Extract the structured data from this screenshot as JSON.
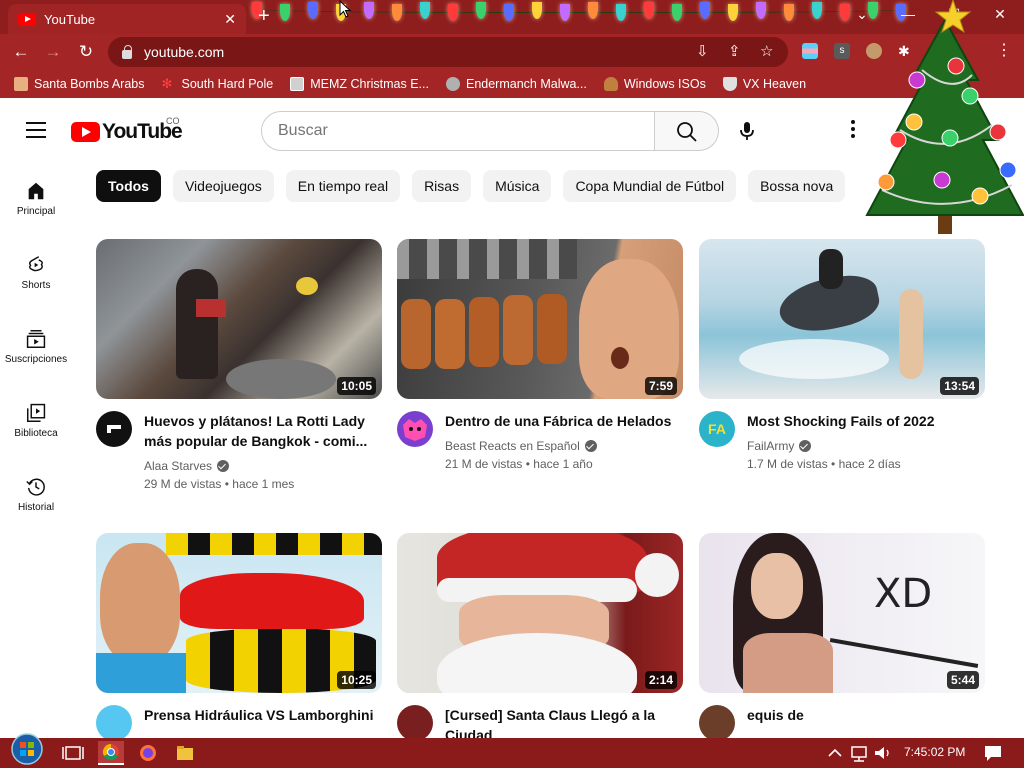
{
  "browser": {
    "tab_title": "YouTube",
    "url": "youtube.com",
    "bookmarks": [
      {
        "label": "Santa Bombs Arabs",
        "icon": "santa-icon",
        "color": "#e8b080"
      },
      {
        "label": "South Hard Pole",
        "icon": "snowflake-icon",
        "color": "#ff4040"
      },
      {
        "label": "MEMZ Christmas E...",
        "icon": "image-icon",
        "color": "#d0d0d0"
      },
      {
        "label": "Endermanch Malwa...",
        "icon": "raccoon-icon",
        "color": "#b0b0b0"
      },
      {
        "label": "Windows ISOs",
        "icon": "gingerbread-icon",
        "color": "#c08040"
      },
      {
        "label": "VX Heaven",
        "icon": "shield-icon",
        "color": "#e0e0e0"
      }
    ]
  },
  "youtube": {
    "logo_text": "YouTube",
    "country": "CO",
    "search_placeholder": "Buscar",
    "chips": [
      "Todos",
      "Videojuegos",
      "En tiempo real",
      "Risas",
      "Música",
      "Copa Mundial de Fútbol",
      "Bossa nova"
    ],
    "sidebar": [
      {
        "label": "Principal",
        "icon": "home-icon"
      },
      {
        "label": "Shorts",
        "icon": "shorts-icon"
      },
      {
        "label": "Suscripciones",
        "icon": "subscriptions-icon"
      },
      {
        "label": "Biblioteca",
        "icon": "library-icon"
      },
      {
        "label": "Historial",
        "icon": "history-icon"
      }
    ],
    "videos": [
      {
        "title": "Huevos y plátanos! La Rotti Lady más popular de Bangkok - comi...",
        "channel": "Alaa Starves",
        "verified": true,
        "views": "29 M de vistas",
        "age": "hace 1 mes",
        "duration": "10:05"
      },
      {
        "title": "Dentro de una Fábrica de Helados",
        "channel": "Beast Reacts en Español",
        "verified": true,
        "views": "21 M de vistas",
        "age": "hace 1 año",
        "duration": "7:59"
      },
      {
        "title": "Most Shocking Fails of 2022",
        "channel": "FailArmy",
        "verified": true,
        "views": "1.7 M de vistas",
        "age": "hace 2 días",
        "duration": "13:54",
        "avatar_text": "FA"
      },
      {
        "title": "Prensa Hidráulica VS Lamborghini",
        "duration": "10:25"
      },
      {
        "title": "[Cursed] Santa Claus Llegó a la Ciudad",
        "duration": "2:14"
      },
      {
        "title": "equis de",
        "duration": "5:44",
        "thumb_text": "XD"
      }
    ],
    "meta_separator": "•"
  },
  "taskbar": {
    "time": "7:45:02 PM"
  },
  "colors": {
    "chrome_dark": "#8e1d1d",
    "chrome": "#a42525",
    "youtube_red": "#ff0000",
    "chip_bg": "#f2f2f2",
    "chip_active": "#0f0f0f"
  }
}
